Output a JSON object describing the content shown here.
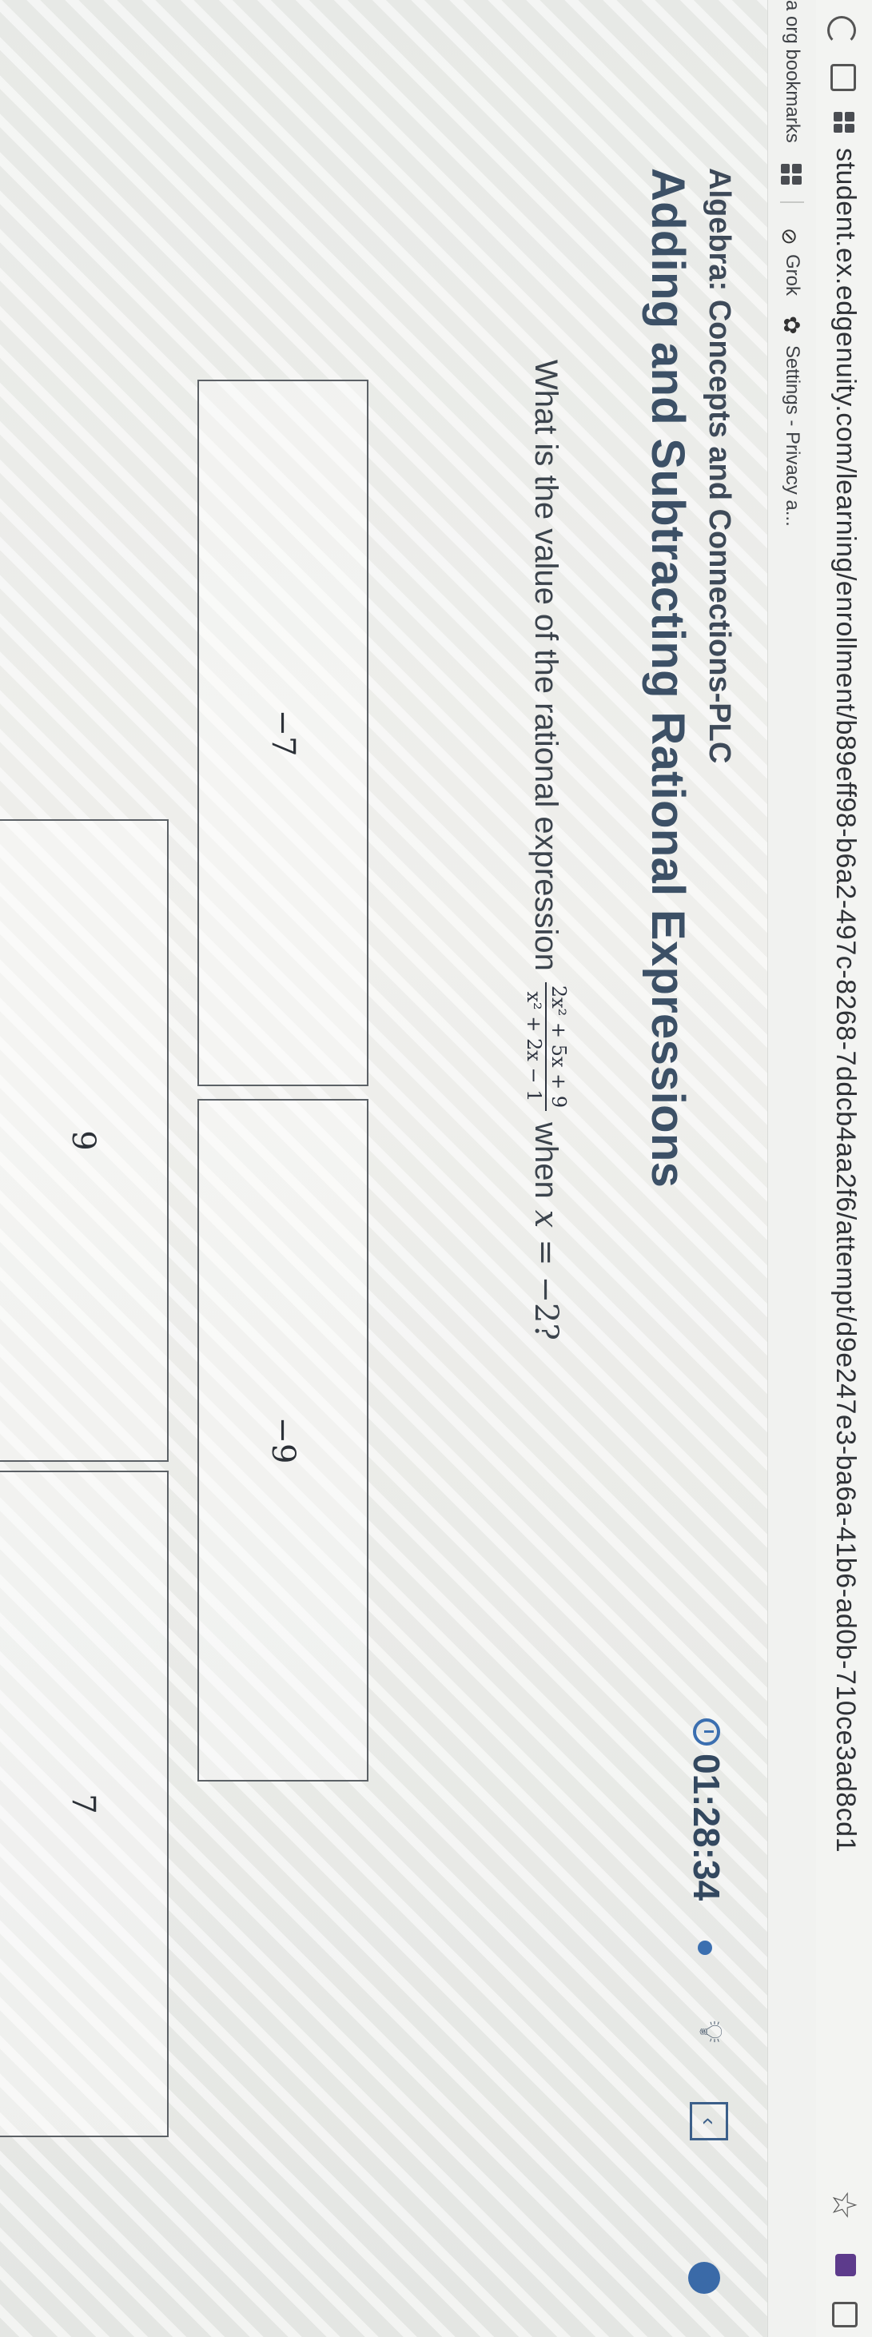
{
  "browser": {
    "url": "student.ex.edgenuity.com/learning/enrollment/b89eff98-b6a2-497c-8268-7ddcb4aa2f6/attempt/d9e247e3-ba6a-41b6-ad0b-710ce3ad8cd1",
    "bookmarks": [
      {
        "label": "a org bookmarks"
      },
      {
        "label": "Grok"
      },
      {
        "label": "Settings - Privacy a..."
      }
    ]
  },
  "course": {
    "title": "Algebra: Concepts and Connections-PLC",
    "lesson": "Adding and Subtracting Rational Expressions"
  },
  "timer": {
    "value": "01:28:34"
  },
  "question": {
    "prefix": "What is the value of the rational expression",
    "numerator": "2x² + 5x + 9",
    "denominator": "x² + 2x − 1",
    "suffix_when": "when",
    "var": "x",
    "equals": "= −2?"
  },
  "choices": [
    {
      "label": "−7"
    },
    {
      "label": "−9"
    },
    {
      "label": "7"
    },
    {
      "label": "9"
    }
  ]
}
